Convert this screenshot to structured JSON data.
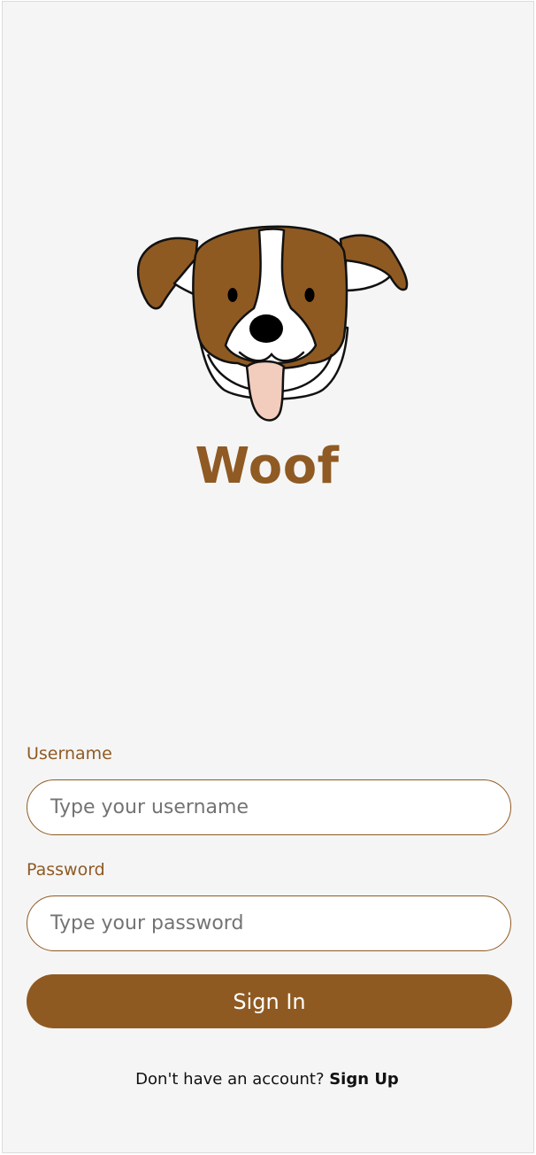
{
  "app": {
    "title": "Woof",
    "logo_icon": "dog-face-icon"
  },
  "form": {
    "username_label": "Username",
    "username_placeholder": "Type your username",
    "username_value": "",
    "password_label": "Password",
    "password_placeholder": "Type your password",
    "password_value": "",
    "signin_label": "Sign In"
  },
  "footer": {
    "prompt": "Don't have an account?",
    "signup_label": "Sign Up"
  },
  "colors": {
    "brand": "#8f5a23",
    "background": "#f5f5f5",
    "tongue": "#f2cdbd"
  }
}
